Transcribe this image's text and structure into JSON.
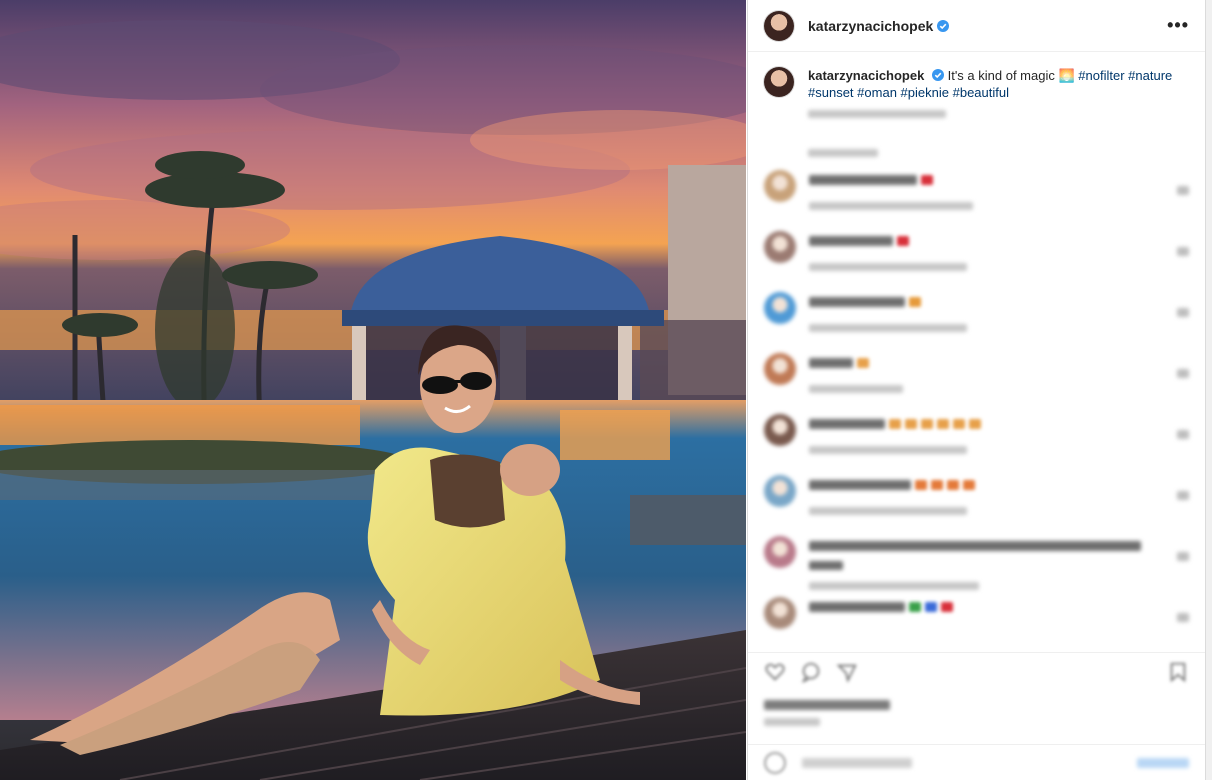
{
  "post": {
    "username": "katarzynacichopek",
    "more_icon": "more-horizontal-icon",
    "verified_icon": "verified-badge-icon"
  },
  "caption": {
    "username": "katarzynacichopek",
    "text": "It's a kind of magic",
    "emoji": "🌅",
    "hashtags": [
      "#nofilter",
      "#nature",
      "#sunset",
      "#oman",
      "#pieknie",
      "#beautiful"
    ]
  },
  "comments": [
    {
      "avatar_color": "#c8a27a",
      "name_w": 108,
      "emoji": [
        "#d8303a"
      ],
      "meta_w": 164
    },
    {
      "avatar_color": "#9b7b72",
      "name_w": 84,
      "emoji": [
        "#d8303a"
      ],
      "meta_w": 158
    },
    {
      "avatar_color": "#4f9ad6",
      "name_w": 96,
      "emoji": [
        "#e69a3a"
      ],
      "meta_w": 158
    },
    {
      "avatar_color": "#c07a56",
      "name_w": 44,
      "emoji": [
        "#e7a04a"
      ],
      "meta_w": 94
    },
    {
      "avatar_color": "#7a5a4e",
      "name_w": 76,
      "emoji": [
        "#e7a04a",
        "#e7a04a",
        "#e7a04a",
        "#e7a04a",
        "#e7a04a",
        "#e7a04a"
      ],
      "meta_w": 158
    },
    {
      "avatar_color": "#7aa7c8",
      "name_w": 102,
      "emoji": [
        "#e47a3a",
        "#e47a3a",
        "#e47a3a",
        "#e47a3a"
      ],
      "meta_w": 158
    },
    {
      "avatar_color": "#b97a8a",
      "name_w": 332,
      "emoji": [],
      "meta_w": 170,
      "second_line_w": 34
    },
    {
      "avatar_color": "#a88a7a",
      "name_w": 96,
      "emoji": [
        "#3aa04a",
        "#3a6ad8",
        "#d8303a"
      ],
      "meta_w": 0
    }
  ],
  "actions": {
    "like_icon": "heart-icon",
    "comment_icon": "comment-icon",
    "share_icon": "share-icon",
    "save_icon": "bookmark-icon"
  },
  "composer": {
    "emoji_icon": "emoji-icon"
  }
}
